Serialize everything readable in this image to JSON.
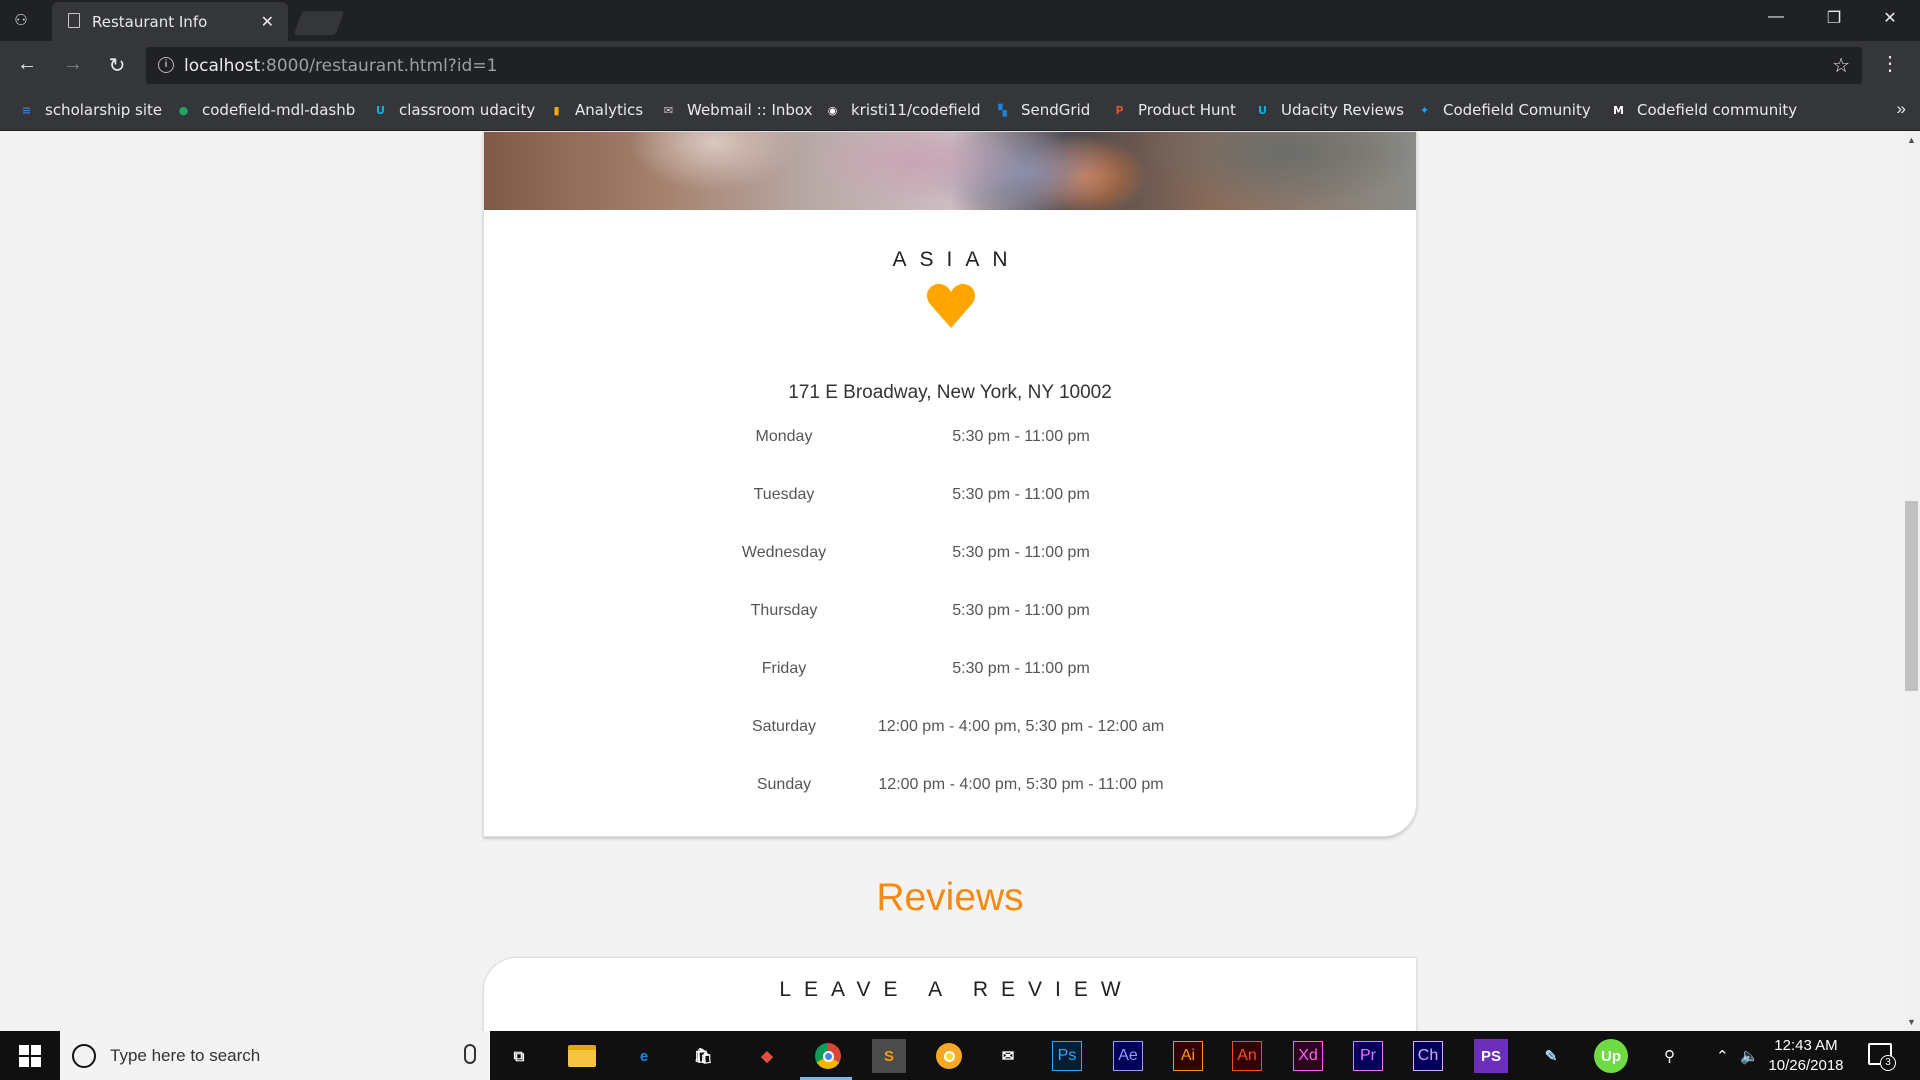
{
  "browser": {
    "tab_title": "Restaurant Info",
    "tab_close": "✕",
    "url_host": "localhost",
    "url_rest": ":8000/restaurant.html?id=1",
    "window_controls": [
      "—",
      "❐",
      "✕"
    ]
  },
  "bookmarks": [
    {
      "label": "scholarship site",
      "icon": "blog-icon",
      "color": "#3f7bd5"
    },
    {
      "label": "codefield-mdl-dashb",
      "icon": "green-circle-icon",
      "color": "#1fa463"
    },
    {
      "label": "classroom udacity",
      "icon": "udacity-icon",
      "color": "#02b3e4"
    },
    {
      "label": "Analytics",
      "icon": "analytics-icon",
      "color": "#f9ab00"
    },
    {
      "label": "Webmail :: Inbox",
      "icon": "mail-icon",
      "color": "#d0d0d0"
    },
    {
      "label": "kristi11/codefield",
      "icon": "github-icon",
      "color": "#ffffff"
    },
    {
      "label": "SendGrid",
      "icon": "sendgrid-icon",
      "color": "#1a82e2"
    },
    {
      "label": "Product Hunt",
      "icon": "producthunt-icon",
      "color": "#da552f"
    },
    {
      "label": "Udacity Reviews",
      "icon": "udacity-icon",
      "color": "#02b3e4"
    },
    {
      "label": "Codefield Comunity",
      "icon": "twitter-icon",
      "color": "#1da1f2"
    },
    {
      "label": "Codefield community",
      "icon": "medium-icon",
      "color": "#ffffff"
    }
  ],
  "restaurant": {
    "cuisine": "ASIAN",
    "address": "171 E Broadway, New York, NY 10002",
    "hours": [
      {
        "day": "Monday",
        "time": "5:30 pm - 11:00 pm"
      },
      {
        "day": "Tuesday",
        "time": "5:30 pm - 11:00 pm"
      },
      {
        "day": "Wednesday",
        "time": "5:30 pm - 11:00 pm"
      },
      {
        "day": "Thursday",
        "time": "5:30 pm - 11:00 pm"
      },
      {
        "day": "Friday",
        "time": "5:30 pm - 11:00 pm"
      },
      {
        "day": "Saturday",
        "time": "12:00 pm - 4:00 pm, 5:30 pm - 12:00 am"
      },
      {
        "day": "Sunday",
        "time": "12:00 pm - 4:00 pm, 5:30 pm - 11:00 pm"
      }
    ],
    "favorite_color": "#ffa500"
  },
  "reviews": {
    "title": "Reviews",
    "leave_review": "LEAVE A REVIEW",
    "accent": "#f58a0f"
  },
  "taskbar": {
    "search_placeholder": "Type here to search",
    "apps": [
      {
        "name": "task-view-icon",
        "text": "⧉",
        "bg": "transparent",
        "fg": "#ffffff"
      },
      {
        "name": "file-explorer-icon",
        "text": "",
        "bg": "#f5c542",
        "fg": "#000"
      },
      {
        "name": "edge-icon",
        "text": "e",
        "bg": "transparent",
        "fg": "#1e88e5"
      },
      {
        "name": "store-icon",
        "text": "🛍",
        "bg": "transparent",
        "fg": "#fff"
      },
      {
        "name": "git-icon",
        "text": "◆",
        "bg": "transparent",
        "fg": "#e84e40"
      },
      {
        "name": "chrome-icon",
        "text": "",
        "bg": "transparent",
        "fg": "#fff"
      },
      {
        "name": "sublime-icon",
        "text": "S",
        "bg": "#4b4b4b",
        "fg": "#ff9800"
      },
      {
        "name": "chrome-canary-icon",
        "text": "",
        "bg": "transparent",
        "fg": "#fff"
      },
      {
        "name": "mail-app-icon",
        "text": "✉",
        "bg": "transparent",
        "fg": "#ffffff"
      },
      {
        "name": "photoshop-icon",
        "text": "Ps",
        "bg": "#001e36",
        "fg": "#31a8ff"
      },
      {
        "name": "after-effects-icon",
        "text": "Ae",
        "bg": "#00005b",
        "fg": "#9999ff"
      },
      {
        "name": "illustrator-icon",
        "text": "Ai",
        "bg": "#330000",
        "fg": "#ff9a00"
      },
      {
        "name": "animate-icon",
        "text": "An",
        "bg": "#330000",
        "fg": "#ff4a20"
      },
      {
        "name": "xd-icon",
        "text": "Xd",
        "bg": "#2e001f",
        "fg": "#ff61f6"
      },
      {
        "name": "premiere-icon",
        "text": "Pr",
        "bg": "#00005b",
        "fg": "#ea77ff"
      },
      {
        "name": "character-animator-icon",
        "text": "Ch",
        "bg": "#00005b",
        "fg": "#d9a8ff"
      },
      {
        "name": "phpstorm-icon",
        "text": "PS",
        "bg": "#6b2fba",
        "fg": "#ffffff"
      },
      {
        "name": "notepad-icon",
        "text": "✎",
        "bg": "transparent",
        "fg": "#9fd3f0"
      },
      {
        "name": "upwork-icon",
        "text": "Up",
        "bg": "#6fda44",
        "fg": "#ffffff"
      }
    ],
    "time": "12:43 AM",
    "date": "10/26/2018",
    "notification_count": "3"
  }
}
